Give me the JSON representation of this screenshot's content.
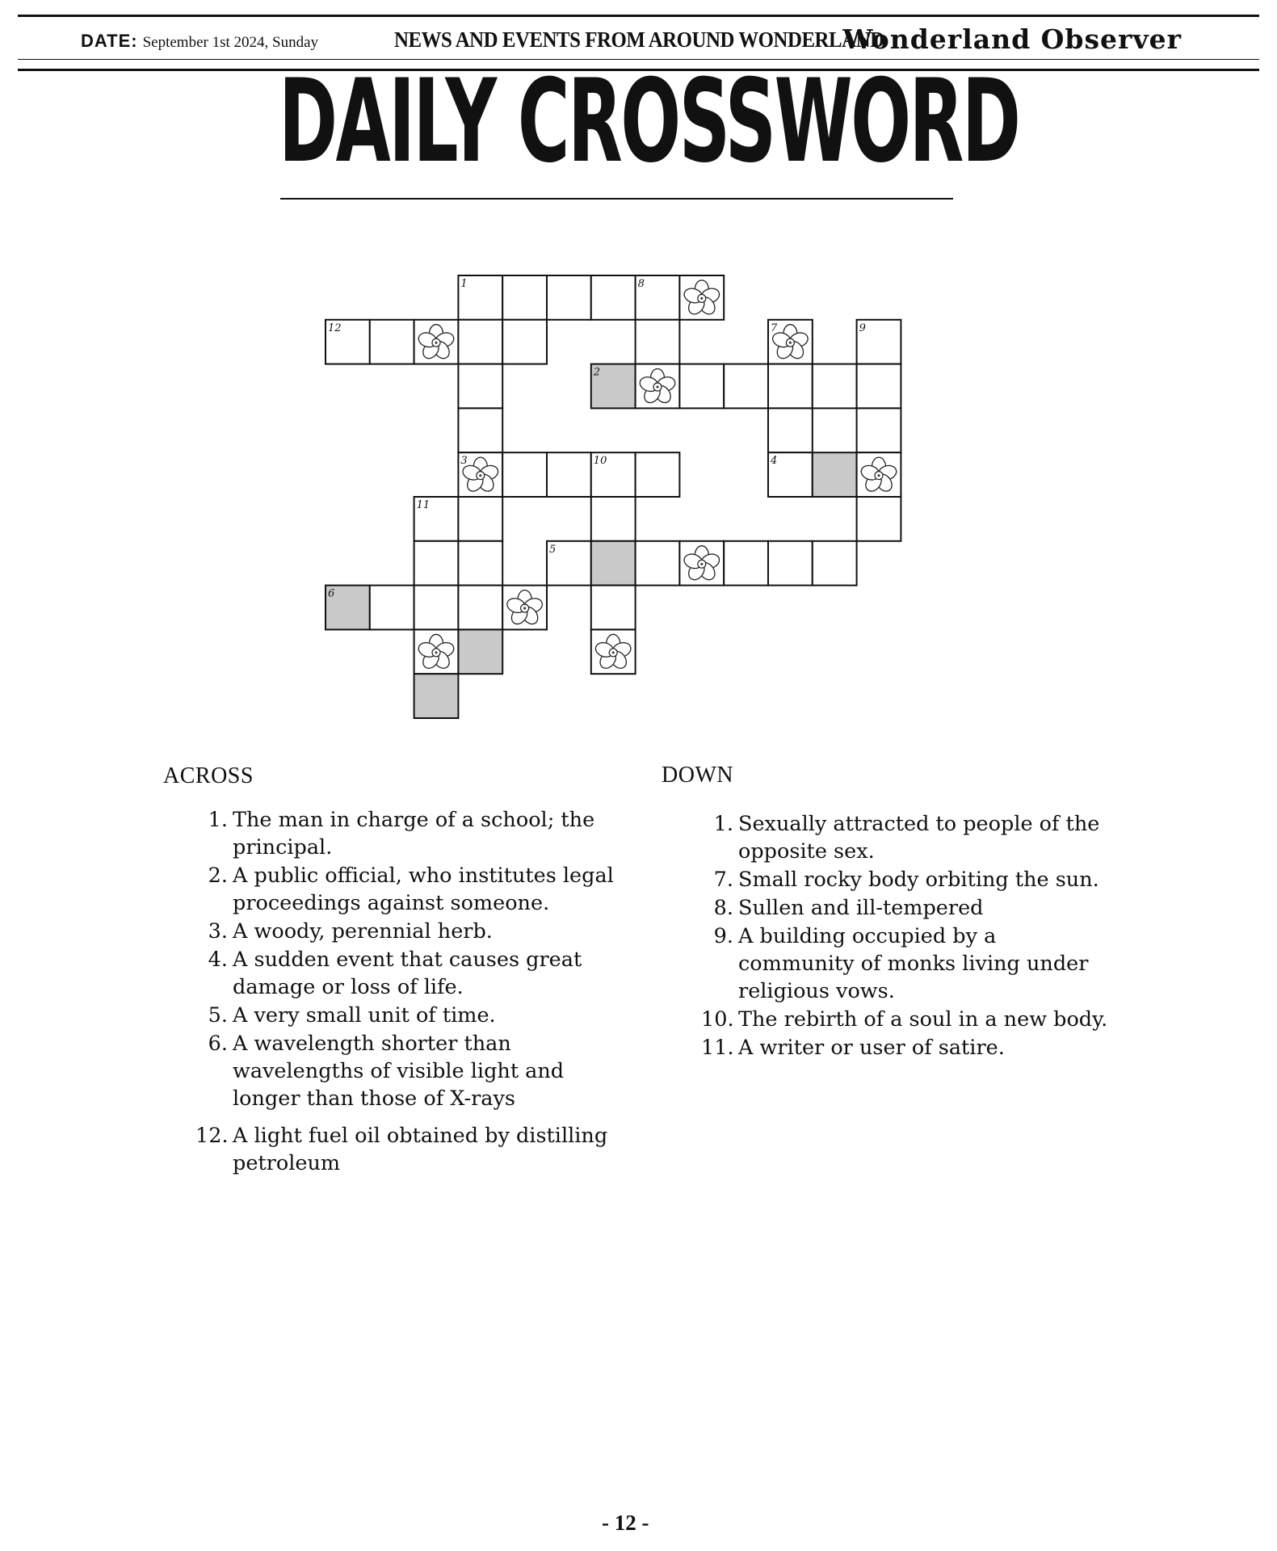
{
  "header": {
    "date_label": "DATE:",
    "date_value": "September 1st 2024, Sunday",
    "tagline": "NEWS AND EVENTS FROM AROUND WONDERLAND",
    "paper_name": "Wonderland Observer"
  },
  "title": "DAILY CROSSWORD",
  "grid": {
    "cell_numbers": [
      "1",
      "2",
      "3",
      "4",
      "5",
      "6",
      "7",
      "8",
      "9",
      "10",
      "11",
      "12"
    ],
    "decorations": [
      "flower-icon",
      "shaded-cell"
    ]
  },
  "across": {
    "heading": "ACROSS",
    "clues": [
      {
        "num": "1.",
        "text": "The man in charge of a school; the principal."
      },
      {
        "num": "2.",
        "text": "A public official, who institutes legal proceedings against someone."
      },
      {
        "num": "3.",
        "text": "A woody, perennial herb."
      },
      {
        "num": "4.",
        "text": "A sudden event that causes great damage or loss of life."
      },
      {
        "num": "5.",
        "text": "A very small unit of time."
      },
      {
        "num": "6.",
        "text": "A wavelength shorter than wavelengths of visible light and longer than those of X-rays"
      },
      {
        "num": "12.",
        "text": "A light fuel oil obtained by distilling petroleum"
      }
    ]
  },
  "down": {
    "heading": "DOWN",
    "clues": [
      {
        "num": "1.",
        "text": "Sexually attracted to people of the opposite sex."
      },
      {
        "num": "7.",
        "text": "Small rocky body orbiting the sun."
      },
      {
        "num": "8.",
        "text": "Sullen and ill-tempered"
      },
      {
        "num": "9.",
        "text": "A building occupied by a community of monks living under religious vows."
      },
      {
        "num": "10.",
        "text": "The rebirth of a soul in a new body."
      },
      {
        "num": "11.",
        "text": "A writer or user of satire."
      }
    ]
  },
  "page_number": "- 12 -"
}
